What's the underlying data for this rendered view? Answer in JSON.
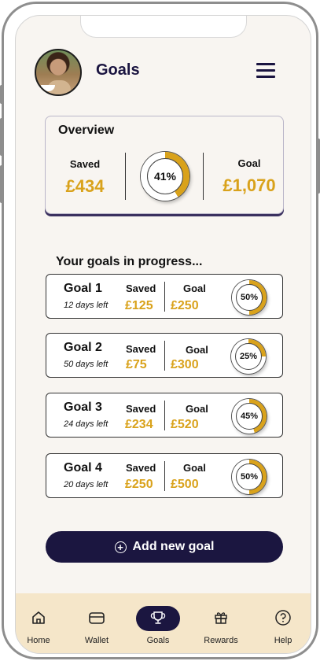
{
  "header": {
    "title": "Goals",
    "avatar_icon": "user-avatar-photo",
    "menu_icon": "hamburger-menu-icon"
  },
  "overview": {
    "title": "Overview",
    "saved_label": "Saved",
    "saved_amount": "£434",
    "progress_text": "41%",
    "progress": 0.41,
    "goal_label": "Goal",
    "goal_amount": "£1,070"
  },
  "goals_section": {
    "title": "Your goals in progress...",
    "items": [
      {
        "name": "Goal 1",
        "days_left": "12 days left",
        "saved_label": "Saved",
        "saved": "£125",
        "goal_label": "Goal",
        "goal": "£250",
        "progress_text": "50%",
        "progress": 0.5
      },
      {
        "name": "Goal 2",
        "days_left": "50 days left",
        "saved_label": "Saved",
        "saved": "£75",
        "goal_label": "Goal",
        "goal": "£300",
        "progress_text": "25%",
        "progress": 0.25
      },
      {
        "name": "Goal 3",
        "days_left": "24 days left",
        "saved_label": "Saved",
        "saved": "£234",
        "goal_label": "Goal",
        "goal": "£520",
        "progress_text": "45%",
        "progress": 0.45
      },
      {
        "name": "Goal 4",
        "days_left": "20 days left",
        "saved_label": "Saved",
        "saved": "£250",
        "goal_label": "Goal",
        "goal": "£500",
        "progress_text": "50%",
        "progress": 0.5
      }
    ]
  },
  "add_button": {
    "label": "Add new goal",
    "icon": "plus-circle-icon"
  },
  "tabbar": {
    "items": [
      {
        "label": "Home",
        "icon": "home-icon"
      },
      {
        "label": "Wallet",
        "icon": "wallet-icon"
      },
      {
        "label": "Goals",
        "icon": "trophy-icon",
        "active": true
      },
      {
        "label": "Rewards",
        "icon": "gift-icon"
      },
      {
        "label": "Help",
        "icon": "help-icon"
      }
    ]
  },
  "colors": {
    "accent": "#d9a21b",
    "navy": "#1b1640",
    "tabbar_bg": "#f5e6c9",
    "screen_bg": "#f8f5f1"
  }
}
